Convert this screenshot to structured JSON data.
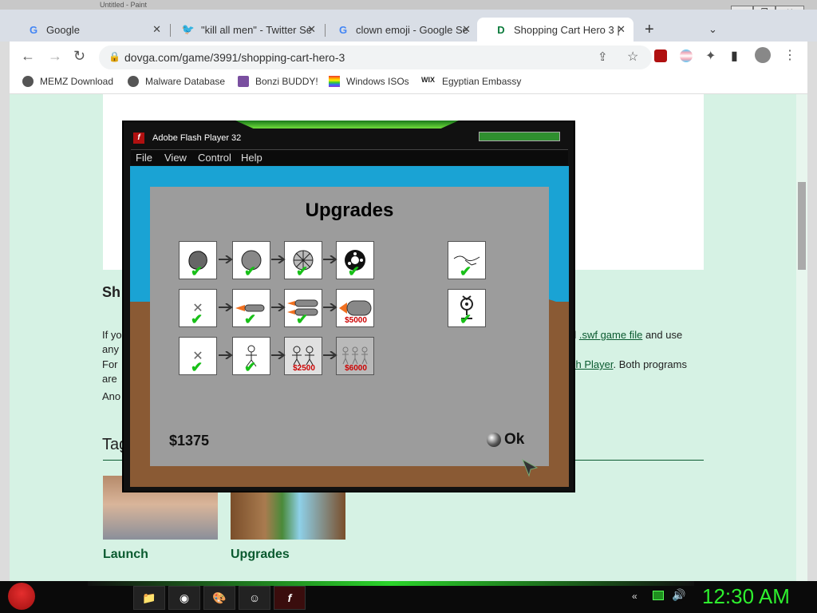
{
  "window": {
    "title": "Untitled - Paint"
  },
  "tabs": [
    {
      "label": "Google",
      "icon": "G",
      "active": false
    },
    {
      "label": "\"kill all men\" - Twitter Se",
      "icon": "twitter-bird",
      "active": false
    },
    {
      "label": "clown emoji - Google Se",
      "icon": "G",
      "active": false
    },
    {
      "label": "Shopping Cart Hero 3 |",
      "icon": "D",
      "active": true
    }
  ],
  "address": {
    "url": "dovga.com/game/3991/shopping-cart-hero-3"
  },
  "bookmarks": [
    "MEMZ Download",
    "Malware Database",
    "Bonzi BUDDY!",
    "Windows ISOs",
    "Egyptian Embassy"
  ],
  "page": {
    "heading_partial": "Sh",
    "para1_left": "If yo",
    "para1_right_prefix": "d ",
    "para1_link": ".swf game file",
    "para1_right_suffix": " and use",
    "para2_left": "any",
    "para3_left": "For",
    "para3_link": "sh Player",
    "para3_right": ". Both programs",
    "para4_left": "are",
    "para5_left": "Ano",
    "tags_partial": "Tag",
    "thumbs": [
      {
        "caption": "Launch"
      },
      {
        "caption": "Upgrades"
      }
    ]
  },
  "flash": {
    "title": "Adobe Flash Player 32",
    "menu": [
      "File",
      "View",
      "Control",
      "Help"
    ],
    "panel_title": "Upgrades",
    "money": "$1375",
    "ok_label": "Ok",
    "prices": [
      "$5000",
      "$2500",
      "$6000"
    ]
  },
  "taskbar": {
    "clock": "12:30 AM"
  }
}
